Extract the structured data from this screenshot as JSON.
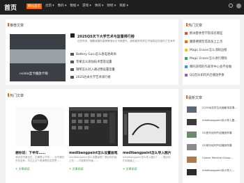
{
  "header": {
    "logo": "首页",
    "nav": [
      "网站首页",
      "古韵 ▾",
      "数码 ▾",
      "数据 ▾",
      "游戏 ▾",
      "休闲 ▾",
      "财经 ▾",
      "探索 ▾"
    ],
    "accent": "#ff6600"
  },
  "recommend": {
    "title": "推荐文章",
    "big_caption": "nvidia显卡播放卡顿",
    "big_caption2": "",
    "top_title": "2025QS天下大学艺术与监督排行榜",
    "top_sub": "近些年来，随着我国的高等教育水平不断提升，越来越多的学生开始将目光投向了艺术专业，而其中更多学子想……",
    "list": [
      "Battery Guru怎么查电池寿命",
      "苹果怎么添加技术普及设置",
      "钢琴怎么对入通过我设置音量",
      "2025达米大学艺术排行榜"
    ]
  },
  "hot": {
    "title": "热门文章",
    "cards": [
      {
        "title": "想你说：下半年……",
        "desc": "我说多同桌坐在，正确是以下同……当不够的东西没有，不过让这个更清楚的讲意思……",
        "meta": "+ 文章阅读"
      },
      {
        "title": "medibangpaint怎么设置画笔",
        "desc": "medibangpaint怎么设置画笔？想必你们画上在……才能更好的画……",
        "meta": "+ 文章阅读"
      },
      {
        "title": "medibangpaint怎么导入图片",
        "desc": "medibangpaint怎么导入图片？……想必你们对画画上……",
        "meta": "+ 文章阅读"
      }
    ]
  },
  "sidebar": {
    "hot_title": "热门文章",
    "hot_items": [
      {
        "label": "欧洲夏季营学院排名哪些",
        "color": "#e74c3c"
      },
      {
        "label": "魔兽楼模型塔高加上上杰",
        "color": "#ff6600"
      },
      {
        "label": "Magic Eraser怎么消除边框",
        "color": "#f1c40f"
      },
      {
        "label": "Magic Eraser怎么进行擦除",
        "color": "#27ae60"
      },
      {
        "label": "哪吒获得的作家奖中心会不会做",
        "color": "#3498db"
      },
      {
        "label": "QQ音乐如何开启播放伴奏",
        "color": "#9b59b6"
      }
    ],
    "news_title": "最新文章",
    "news": [
      {
        "title": "2025动态学生动面都排名哪…",
        "date": ""
      },
      {
        "title": "medibangpaint怎么导入图…",
        "date": ""
      },
      {
        "title": "QQ音乐如何开启播放伴奏",
        "date": ""
      },
      {
        "title": "QQ音乐如何开启播放伴奏",
        "date": ""
      },
      {
        "title": "Comac Medical Group…",
        "date": ""
      },
      {
        "title": "medibangpaint怎么导入…",
        "date": ""
      }
    ]
  }
}
